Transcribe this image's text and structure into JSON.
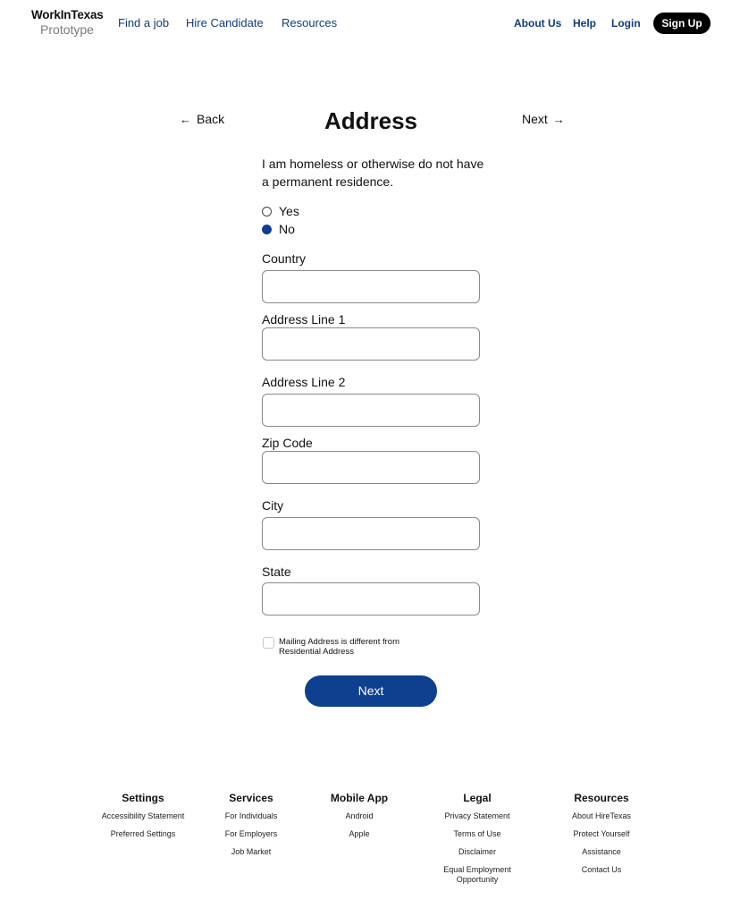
{
  "header": {
    "logo_brand": "WorkInTexas",
    "logo_sub": "Prototype",
    "nav_left": [
      "Find a job",
      "Hire Candidate",
      "Resources"
    ],
    "nav_right": [
      "About Us",
      "Help",
      "Login"
    ],
    "signup_label": "Sign Up"
  },
  "page_nav": {
    "back_label": "Back",
    "title": "Address",
    "next_label": "Next"
  },
  "form": {
    "question": "I am homeless or otherwise do not have a permanent residence.",
    "options": [
      {
        "label": "Yes",
        "selected": false
      },
      {
        "label": "No",
        "selected": true
      }
    ],
    "fields": [
      {
        "label": "Country",
        "value": "",
        "placeholder": ""
      },
      {
        "label": "Address Line 1",
        "value": "",
        "placeholder": ""
      },
      {
        "label": "Address Line 2",
        "value": "",
        "placeholder": ""
      },
      {
        "label": "Zip Code",
        "value": "",
        "placeholder": ""
      },
      {
        "label": "City",
        "value": "",
        "placeholder": ""
      },
      {
        "label": "State",
        "value": "",
        "placeholder": ""
      }
    ],
    "mailing_checkbox_label": "Mailing Address is different from Residential Address",
    "mailing_checked": false,
    "submit_label": "Next"
  },
  "footer": {
    "columns": [
      {
        "heading": "Settings",
        "items": [
          "Accessibility Statement",
          "Preferred Settings"
        ]
      },
      {
        "heading": "Services",
        "items": [
          "For Individuals",
          "For Employers",
          "Job Market"
        ]
      },
      {
        "heading": "Mobile App",
        "items": [
          "Android",
          "Apple"
        ]
      },
      {
        "heading": "Legal",
        "items": [
          "Privacy Statement",
          "Terms of Use",
          "Disclaimer",
          "Equal Employment Opportunity"
        ]
      },
      {
        "heading": "Resources",
        "items": [
          "About HireTexas",
          "Protect Yourself",
          "Assistance",
          "Contact Us"
        ]
      }
    ]
  },
  "colors": {
    "primary": "#0f3f8f",
    "nav_text": "#123d7a",
    "signup_bg": "#000000"
  }
}
